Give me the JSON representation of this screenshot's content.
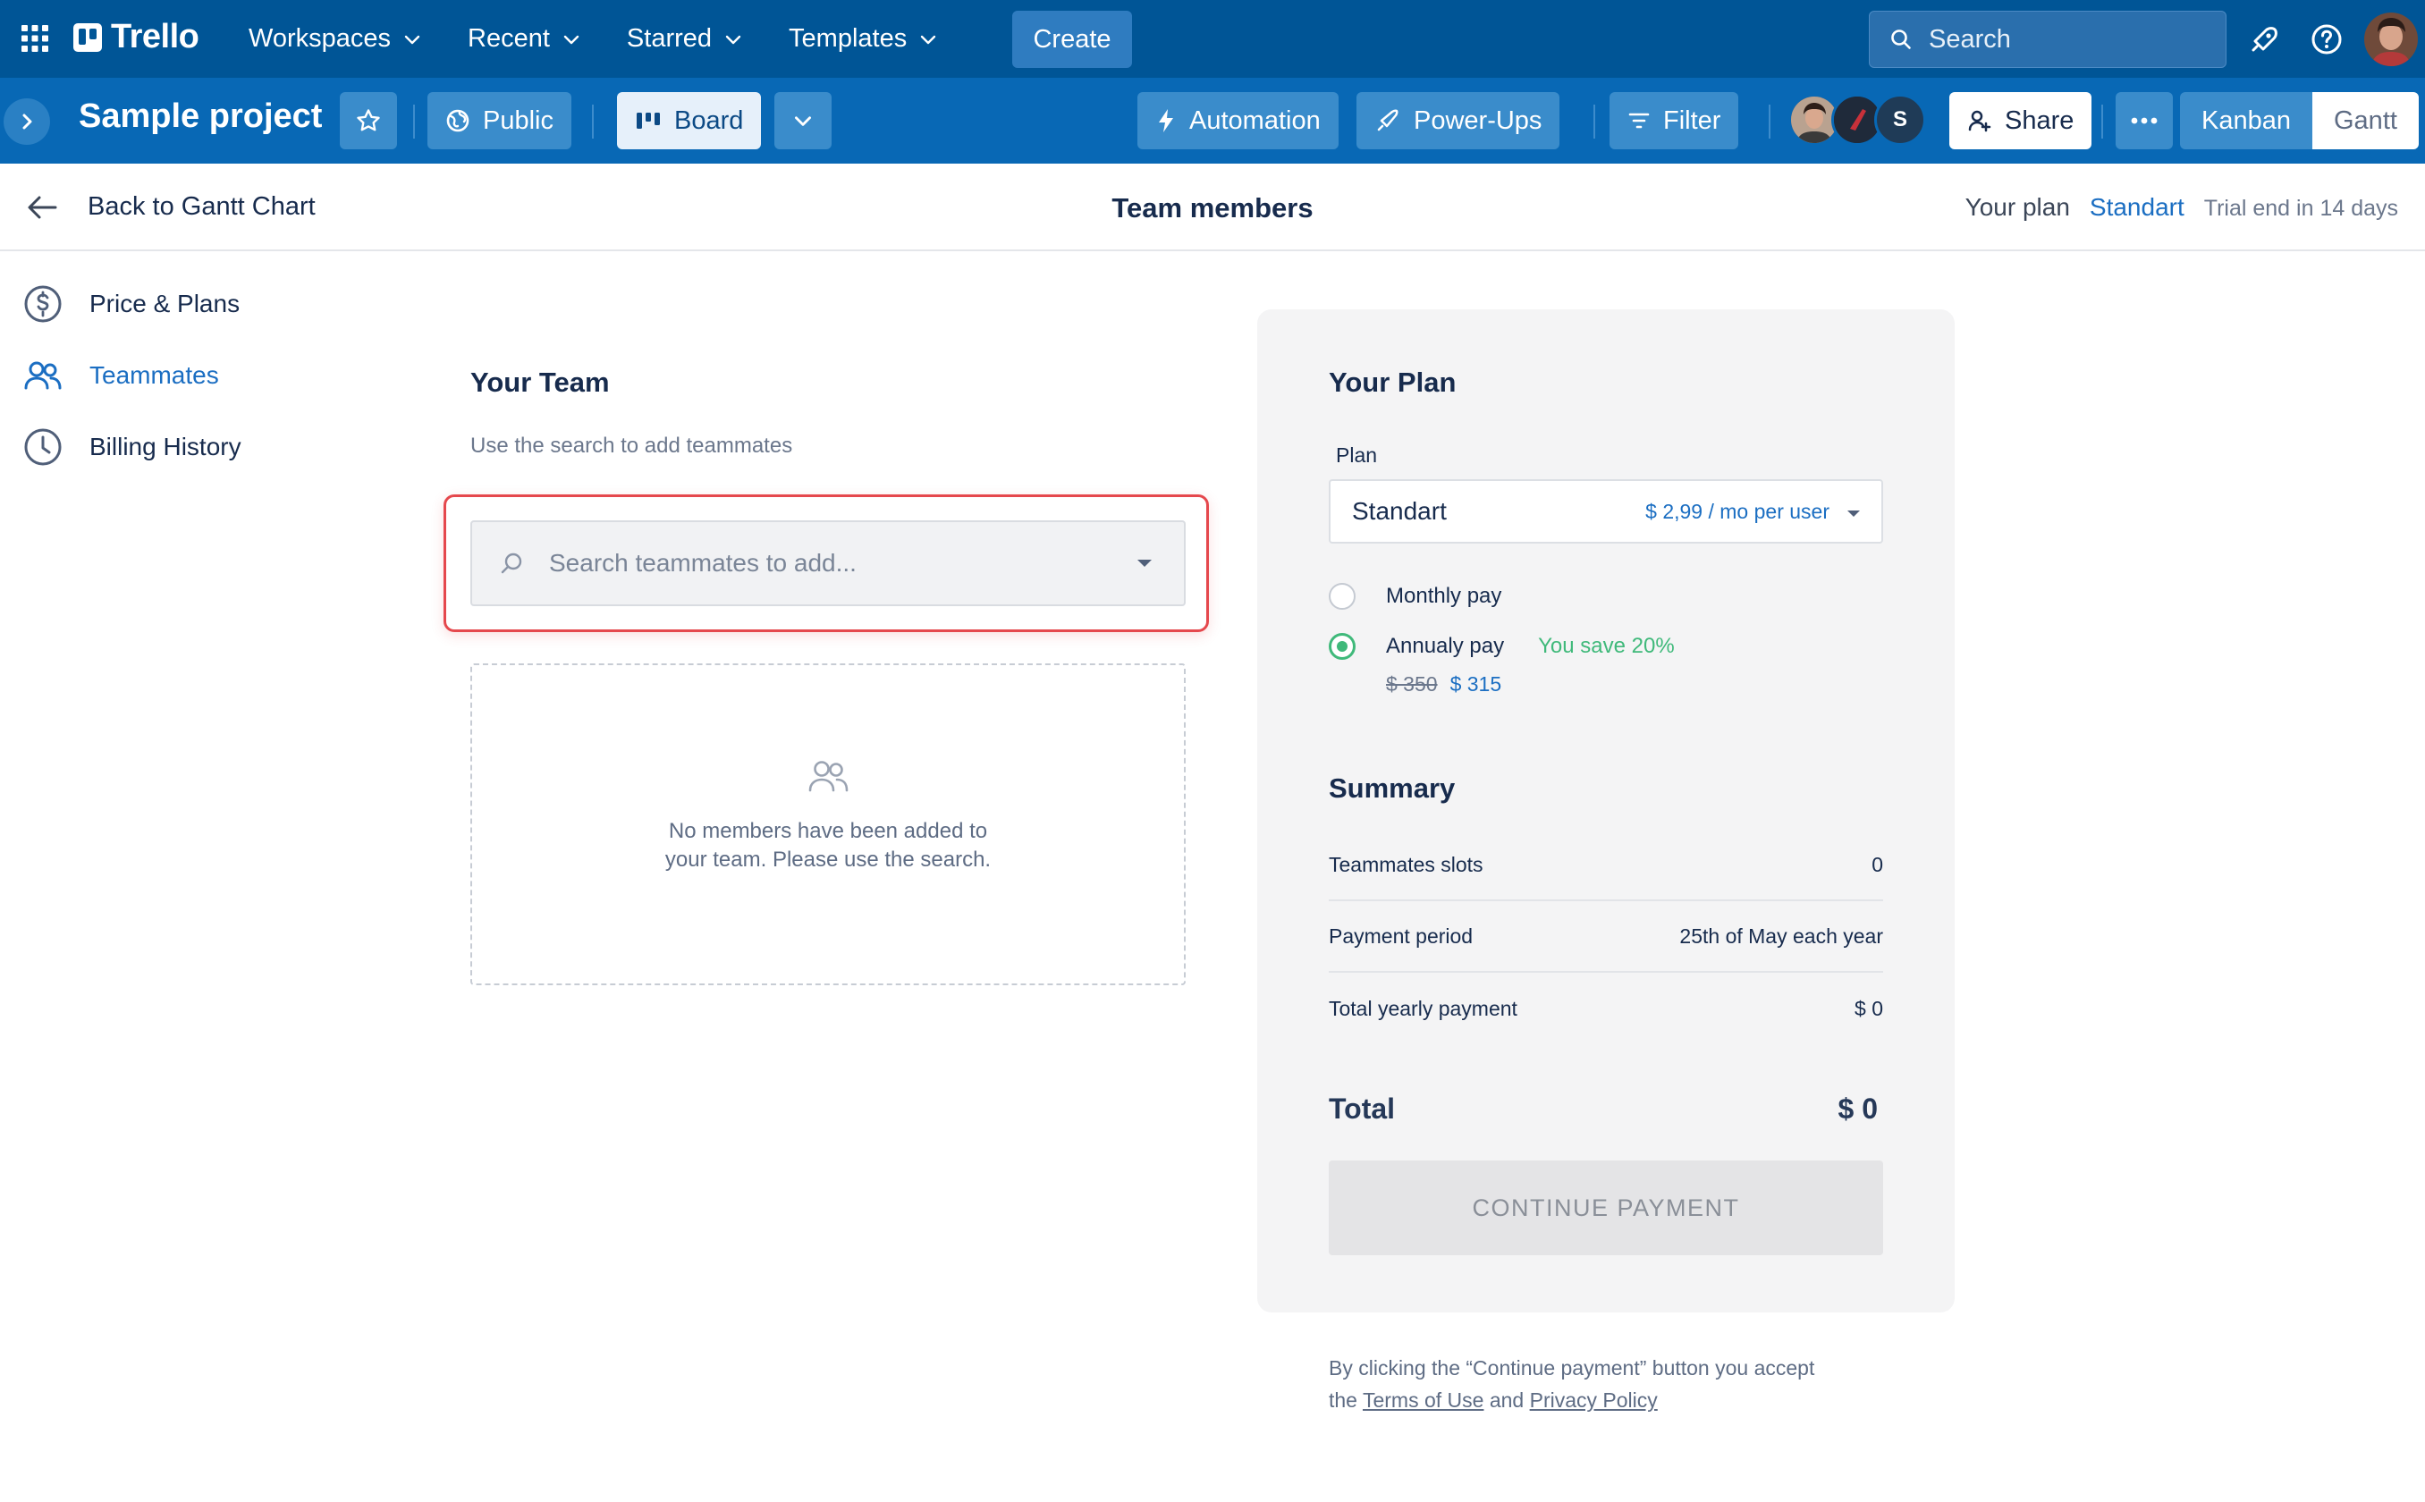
{
  "topbar": {
    "logo": "Trello",
    "nav": [
      {
        "label": "Workspaces"
      },
      {
        "label": "Recent"
      },
      {
        "label": "Starred"
      },
      {
        "label": "Templates"
      }
    ],
    "create_label": "Create",
    "search_label": "Search"
  },
  "board": {
    "title": "Sample project",
    "visibility_label": "Public",
    "view_label": "Board",
    "automation_label": "Automation",
    "powerups_label": "Power-Ups",
    "filter_label": "Filter",
    "members": [
      {
        "initial": "",
        "color": "#8a5a44"
      },
      {
        "initial": "",
        "color": "#1f2a3a"
      },
      {
        "initial": "S",
        "color": "#1f3b57"
      }
    ],
    "share_label": "Share",
    "views": {
      "kanban": "Kanban",
      "gantt": "Gantt"
    }
  },
  "header": {
    "back_label": "Back to Gantt Chart",
    "title": "Team members",
    "plan_label": "Your plan",
    "plan_value": "Standart",
    "trial_text": "Trial end in 14 days"
  },
  "leftnav": {
    "items": [
      {
        "label": "Price & Plans",
        "icon": "dollar-circle-icon",
        "active": false
      },
      {
        "label": "Teammates",
        "icon": "users-icon",
        "active": true
      },
      {
        "label": "Billing History",
        "icon": "clock-icon",
        "active": false
      }
    ]
  },
  "team": {
    "title": "Your Team",
    "hint": "Use the search to add teammates",
    "search_placeholder": "Search teammates to add...",
    "empty_text": "No members have been added to your team. Please use the search."
  },
  "plan": {
    "title": "Your Plan",
    "plan_label": "Plan",
    "selected_plan": "Standart",
    "selected_price": "$ 2,99 / mo per user",
    "monthly_label": "Monthly pay",
    "annual_label": "Annualy pay",
    "annual_save": "You save 20%",
    "annual_old_price": "$ 350",
    "annual_new_price": "$ 315",
    "billing_selected": "annual",
    "summary_title": "Summary",
    "summary": [
      {
        "label": "Teammates slots",
        "value": "0"
      },
      {
        "label": "Payment period",
        "value": "25th of May each year"
      },
      {
        "label": "Total yearly payment",
        "value": "$ 0"
      }
    ],
    "total_label": "Total",
    "total_value": "$ 0",
    "continue_label": "CONTINUE PAYMENT"
  },
  "legal": {
    "text_before": "By clicking the “Continue payment” button you accept the",
    "terms_link": "Terms of Use",
    "and": "and",
    "privacy_link": "Privacy Policy"
  },
  "colors": {
    "topbar": "#005596",
    "boardbar": "#0868b5",
    "accent": "#1b6ec2",
    "success": "#3fb97a",
    "highlight": "#e5484d"
  }
}
